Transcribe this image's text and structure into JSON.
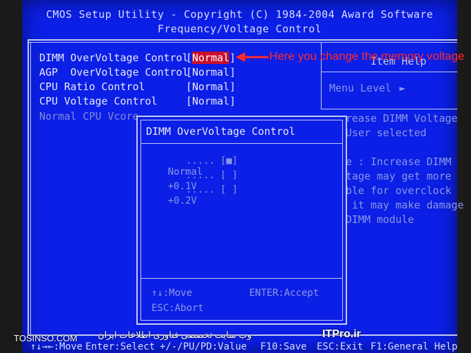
{
  "header": {
    "line1": "CMOS Setup Utility - Copyright (C) 1984-2004 Award Software",
    "line2": "Frequency/Voltage Control"
  },
  "items": [
    {
      "label": "DIMM OverVoltage Control",
      "value": "[Normal]",
      "value_inner": "Normal"
    },
    {
      "label": "AGP  OverVoltage Control",
      "value": "[Normal]"
    },
    {
      "label": "CPU Ratio Control",
      "value": "[Normal]"
    },
    {
      "label": "CPU Voltage Control",
      "value": "[Normal]"
    }
  ],
  "disabled_item": "Normal CPU Vcore",
  "help_panel": {
    "title_partial": "Item Help",
    "menu_level": "Menu Level",
    "menu_level_arrow": "►",
    "text": [
      "rease DIMM Voltage",
      "User selected",
      "",
      "e : Increase DIMM",
      "tage may get more",
      "ble for overclock",
      " it may make damage",
      "DIMM module"
    ]
  },
  "popup": {
    "title": "DIMM OverVoltage Control",
    "options": [
      {
        "label": "Normal",
        "dots": ".....",
        "box": "[■]"
      },
      {
        "label": "+0.1V",
        "dots": ".....",
        "box": "[ ]"
      },
      {
        "label": "+0.2V",
        "dots": ".....",
        "box": "[ ]"
      }
    ],
    "footer_move": "↑↓:Move",
    "footer_accept": "ENTER:Accept",
    "footer_abort": "ESC:Abort"
  },
  "bottom_bar": {
    "move": "↑↓→←:Move",
    "select": "Enter:Select",
    "value": "+/-/PU/PD:Value",
    "save": "F10:Save",
    "exit": "ESC:Exit",
    "help": "F1:General Help"
  },
  "annotation": "Here you change the memory voltage",
  "watermarks": {
    "left": "TOSINSO.COM",
    "center_brand": "ITPro.ir",
    "center_text": "- وب سایت تخصصی فناوری اطلاعات ایران"
  },
  "colors": {
    "screen_bg": "#0b1fe6",
    "text": "#e8e8ff",
    "muted_text": "#8a96e6",
    "highlight": "#c8102e",
    "annotation": "#ff2a2a"
  }
}
